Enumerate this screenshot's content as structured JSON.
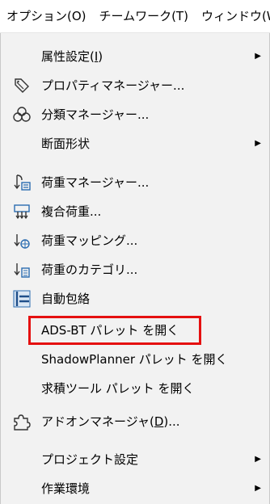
{
  "menubar": {
    "items": [
      {
        "label": "オプション(O)"
      },
      {
        "label": "チームワーク(T)"
      },
      {
        "label": "ウィンドウ(W"
      }
    ]
  },
  "menu": {
    "items": [
      {
        "pre": "属性設定(",
        "accel": "I",
        "post": ")",
        "icon": "",
        "has_submenu": true
      },
      {
        "label": "プロパティマネージャー...",
        "icon": "tag-icon",
        "has_submenu": false
      },
      {
        "label": "分類マネージャー...",
        "icon": "classification-icon",
        "has_submenu": false
      },
      {
        "label": "断面形状",
        "icon": "",
        "has_submenu": true
      },
      {
        "label": "荷重マネージャー...",
        "icon": "load-manager-icon",
        "has_submenu": false
      },
      {
        "label": "複合荷重...",
        "icon": "load-combination-icon",
        "has_submenu": false
      },
      {
        "label": "荷重マッピング...",
        "icon": "load-mapping-icon",
        "has_submenu": false
      },
      {
        "label": "荷重のカテゴリ...",
        "icon": "load-category-icon",
        "has_submenu": false
      },
      {
        "label": "自動包絡",
        "icon": "auto-envelope-icon",
        "has_submenu": false
      },
      {
        "label": "ADS-BT パレット を開く",
        "icon": "",
        "has_submenu": false,
        "highlighted": true
      },
      {
        "label": "ShadowPlanner パレット を開く",
        "icon": "",
        "has_submenu": false
      },
      {
        "label": "求積ツール パレット を開く",
        "icon": "",
        "has_submenu": false
      },
      {
        "pre": "アドオンマネージャ(",
        "accel": "D",
        "post": ")...",
        "icon": "puzzle-icon",
        "has_submenu": false
      },
      {
        "label": "プロジェクト設定",
        "icon": "",
        "has_submenu": true
      },
      {
        "label": "作業環境",
        "icon": "",
        "has_submenu": true
      }
    ],
    "submenu_arrow": "▶",
    "highlight_color": "#e51010"
  }
}
